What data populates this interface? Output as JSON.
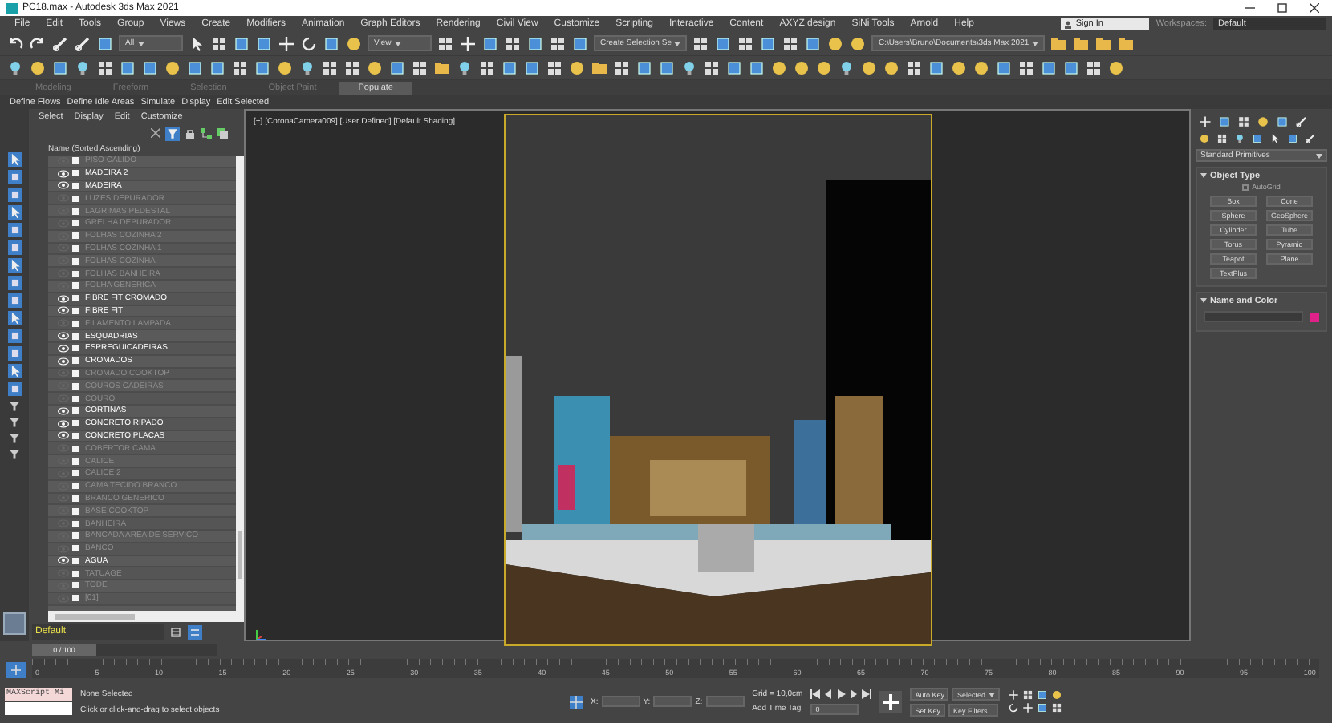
{
  "window": {
    "title": "PC18.max - Autodesk 3ds Max 2021"
  },
  "menu": [
    "File",
    "Edit",
    "Tools",
    "Group",
    "Views",
    "Create",
    "Modifiers",
    "Animation",
    "Graph Editors",
    "Rendering",
    "Civil View",
    "Customize",
    "Scripting",
    "Interactive",
    "Content",
    "AXYZ design",
    "SiNi Tools",
    "Arnold",
    "Help"
  ],
  "account": {
    "sign_in": "Sign In",
    "workspaces_label": "Workspaces:",
    "workspace": "Default"
  },
  "main_toolbar": {
    "dropdowns": [
      "All",
      "View",
      "Create Selection Se",
      "C:\\Users\\Bruno\\Documents\\3ds Max 2021"
    ]
  },
  "ribbon": {
    "tabs": [
      {
        "label": "Modeling",
        "selected": false
      },
      {
        "label": "Freeform",
        "selected": false
      },
      {
        "label": "Selection",
        "selected": false
      },
      {
        "label": "Object Paint",
        "selected": false
      },
      {
        "label": "Populate",
        "selected": true
      }
    ],
    "commands": [
      "Define Flows",
      "Define Idle Areas",
      "Simulate",
      "Display",
      "Edit Selected"
    ]
  },
  "scene_explorer": {
    "tabs": [
      "Select",
      "Display",
      "Edit",
      "Customize"
    ],
    "header": "Name (Sorted Ascending)",
    "items": [
      {
        "name": "PISO CALIDO",
        "visible": false
      },
      {
        "name": "MADEIRA 2",
        "visible": true
      },
      {
        "name": "MADEIRA",
        "visible": true
      },
      {
        "name": "LUZES DEPURADOR",
        "visible": false
      },
      {
        "name": "LAGRIMAS PEDESTAL",
        "visible": false
      },
      {
        "name": "GRELHA DEPURADOR",
        "visible": false
      },
      {
        "name": "FOLHAS COZINHA 2",
        "visible": false
      },
      {
        "name": "FOLHAS COZINHA 1",
        "visible": false
      },
      {
        "name": "FOLHAS COZINHA",
        "visible": false
      },
      {
        "name": "FOLHAS BANHEIRA",
        "visible": false
      },
      {
        "name": "FOLHA GENERICA",
        "visible": false
      },
      {
        "name": "FIBRE FIT CROMADO",
        "visible": true
      },
      {
        "name": "FIBRE FIT",
        "visible": true
      },
      {
        "name": "FILAMENTO LAMPADA",
        "visible": false
      },
      {
        "name": "ESQUADRIAS",
        "visible": true
      },
      {
        "name": "ESPREGUICADEIRAS",
        "visible": true
      },
      {
        "name": "CROMADOS",
        "visible": true
      },
      {
        "name": "CROMADO COOKTOP",
        "visible": false
      },
      {
        "name": "COUROS CADEIRAS",
        "visible": false
      },
      {
        "name": "COURO",
        "visible": false
      },
      {
        "name": "CORTINAS",
        "visible": true
      },
      {
        "name": "CONCRETO RIPADO",
        "visible": true
      },
      {
        "name": "CONCRETO PLACAS",
        "visible": true
      },
      {
        "name": "COBERTOR CAMA",
        "visible": false
      },
      {
        "name": "CALICE",
        "visible": false
      },
      {
        "name": "CALICE 2",
        "visible": false
      },
      {
        "name": "CAMA TECIDO BRANCO",
        "visible": false
      },
      {
        "name": "BRANCO GENERICO",
        "visible": false
      },
      {
        "name": "BASE COOKTOP",
        "visible": false
      },
      {
        "name": "BANHEIRA",
        "visible": false
      },
      {
        "name": "BANCADA AREA DE SERVICO",
        "visible": false
      },
      {
        "name": "BANCO",
        "visible": false
      },
      {
        "name": "AGUA",
        "visible": true
      },
      {
        "name": "TATUAGE",
        "visible": false
      },
      {
        "name": "TODE",
        "visible": false
      },
      {
        "name": "[01]",
        "visible": false
      }
    ],
    "layer": "Default"
  },
  "viewport": {
    "label": "[+] [CoronaCamera009] [User Defined] [Default Shading]"
  },
  "command_panel": {
    "category": "Standard Primitives",
    "object_type": {
      "title": "Object Type",
      "autogrid": {
        "label": "AutoGrid",
        "checked": false
      },
      "buttons": [
        "Box",
        "Cone",
        "Sphere",
        "GeoSphere",
        "Cylinder",
        "Tube",
        "Torus",
        "Pyramid",
        "Teapot",
        "Plane",
        "TextPlus"
      ]
    },
    "name_and_color": {
      "title": "Name and Color"
    }
  },
  "time_slider": {
    "reading": "0 / 100",
    "level": 0
  },
  "timeline": {
    "ticks": [
      "0",
      "5",
      "10",
      "15",
      "20",
      "25",
      "30",
      "35",
      "40",
      "45",
      "50",
      "55",
      "60",
      "65",
      "70",
      "75",
      "80",
      "85",
      "90",
      "95",
      "100"
    ]
  },
  "status": {
    "maxscript": "MAXScript Mi",
    "selection": "None Selected",
    "prompt": "Click or click-and-drag to select objects",
    "x_label": "X:",
    "y_label": "Y:",
    "z_label": "Z:",
    "grid": "Grid = 10,0cm",
    "add_time_tag": "Add Time Tag",
    "auto_key": "Auto Key",
    "key_mode": "Selected",
    "set_key": "Set Key",
    "key_filters": "Key Filters...",
    "frame": "0"
  }
}
